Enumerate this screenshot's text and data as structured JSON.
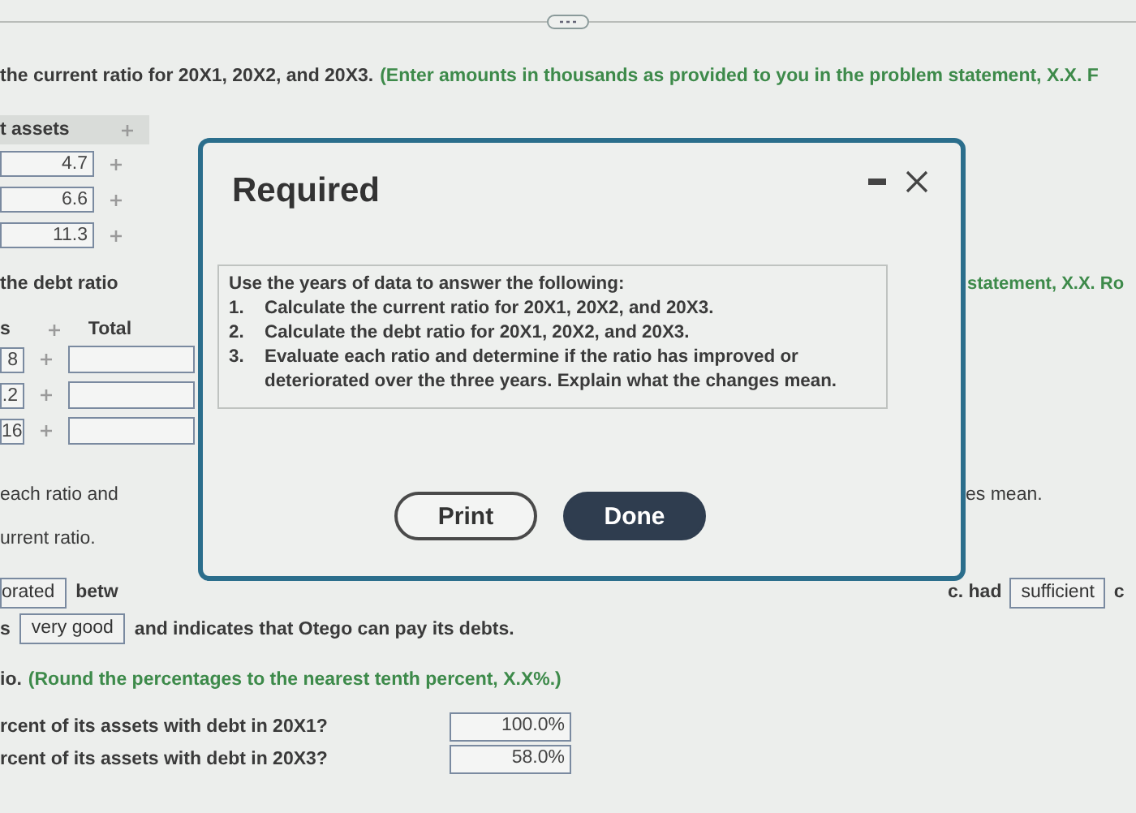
{
  "question_line": {
    "text": "the current ratio for 20X1, 20X2, and 20X3.",
    "note": "(Enter amounts in thousands as provided to you in the problem statement, X.X. F"
  },
  "current_table": {
    "header": "t assets",
    "rows": [
      "4.7",
      "6.6",
      "11.3"
    ]
  },
  "debt_line": {
    "text": "the debt ratio",
    "note": "statement, X.X. Ro"
  },
  "debt_table": {
    "header_1": "s",
    "header_2": "Total",
    "rows": [
      "8",
      ".2",
      "16"
    ]
  },
  "eval_line": {
    "left": "each ratio and",
    "right": "es mean."
  },
  "current_ratio_line": "urrent ratio.",
  "answer_line_1": {
    "choice_1": "orated",
    "text_1": "betw",
    "text_2": "c. had",
    "choice_2": "sufficient",
    "text_3": "c"
  },
  "answer_line_2": {
    "text_1": "s",
    "choice": "very good",
    "text_2": "and indicates that Otego can pay its debts."
  },
  "round_line": {
    "text": "io.",
    "note": "(Round the percentages to the nearest tenth percent, X.X%.)"
  },
  "percent_questions": [
    {
      "question": "rcent of its assets with debt in 20X1?",
      "answer": "100.0%"
    },
    {
      "question": "rcent of its assets with debt in 20X3?",
      "answer": "58.0%"
    }
  ],
  "dialog": {
    "title": "Required",
    "intro": "Use the years of data to answer the following:",
    "steps": [
      {
        "number": "1.",
        "text": "Calculate the current ratio for 20X1, 20X2, and 20X3."
      },
      {
        "number": "2.",
        "text": "Calculate the debt ratio for 20X1, 20X2, and 20X3."
      },
      {
        "number": "3.",
        "text": "Evaluate each ratio and determine if the ratio has improved or deteriorated over the three years. Explain what the changes mean."
      }
    ],
    "buttons": [
      {
        "label": "Print",
        "kind": "secondary"
      },
      {
        "label": "Done",
        "kind": "primary"
      }
    ]
  }
}
